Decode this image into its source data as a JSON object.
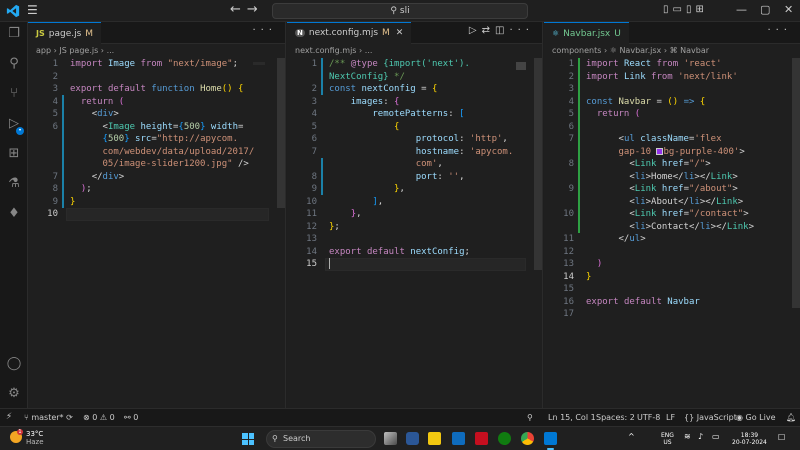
{
  "titlebar": {
    "search_text": "sli",
    "menu_icon": "hamburger-menu-icon",
    "controls": {
      "minimize": "—",
      "maximize": "▢",
      "close": "✕"
    }
  },
  "activity_bar": {
    "items": [
      "explorer-icon",
      "search-icon",
      "source-control-icon",
      "run-debug-icon",
      "extensions-icon",
      "testing-icon",
      "mongodb-leaf-icon"
    ],
    "bottom": [
      "account-icon",
      "settings-gear-icon"
    ]
  },
  "editors": [
    {
      "tab": {
        "icon_text": "JS",
        "name": "page.js",
        "status": "M"
      },
      "breadcrumb": [
        "app",
        "JS page.js",
        "..."
      ],
      "lines": [
        {
          "n": "1",
          "html": "<span class='kw'>import</span> <span class='var'>Image</span> <span class='kw'>from</span> <span class='str'>\"next/image\"</span><span class='plain'>;</span>"
        },
        {
          "n": "2",
          "html": ""
        },
        {
          "n": "3",
          "html": "<span class='kw'>export</span> <span class='kw'>default</span> <span class='kw2'>function</span> <span class='fn'>Home</span><span class='bracket1'>()</span> <span class='bracket1'>{</span>"
        },
        {
          "n": "4",
          "html": "  <span class='kw'>return</span> <span class='bracket2'>(</span>"
        },
        {
          "n": "5",
          "html": "    <span class='plain'>&lt;</span><span class='tag'>div</span><span class='plain'>&gt;</span>"
        },
        {
          "n": "6",
          "html": "      <span class='plain'>&lt;</span><span class='type'>Image</span> <span class='attr'>height</span><span class='plain'>=</span><span class='bracket3'>{</span><span class='num'>500</span><span class='bracket3'>}</span> <span class='attr'>width</span><span class='plain'>=</span>"
        },
        {
          "n": "",
          "html": "      <span class='bracket3'>{</span><span class='num'>500</span><span class='bracket3'>}</span> <span class='attr'>src</span><span class='plain'>=</span><span class='str'>\"http://apycom.</span>"
        },
        {
          "n": "",
          "html": "      <span class='str'>com/webdev/data/upload/2017/</span>"
        },
        {
          "n": "",
          "html": "      <span class='str'>05/image-slider1200.jpg\"</span> <span class='plain'>/&gt;</span>"
        },
        {
          "n": "7",
          "html": "    <span class='plain'>&lt;/</span><span class='tag'>div</span><span class='plain'>&gt;</span>"
        },
        {
          "n": "8",
          "html": "  <span class='bracket2'>)</span><span class='plain'>;</span>"
        },
        {
          "n": "9",
          "html": "<span class='bracket1'>}</span>"
        },
        {
          "n": "10",
          "html": ""
        }
      ]
    },
    {
      "tab": {
        "icon_text": "N",
        "name": "next.config.mjs",
        "status": "M"
      },
      "breadcrumb": [
        "next.config.mjs",
        "..."
      ],
      "lines": [
        {
          "n": "1",
          "html": "<span class='cmt'>/** </span><span class='kw'>@type</span> <span class='type'>{import('next').</span>"
        },
        {
          "n": "",
          "html": "<span class='type'>NextConfig}</span><span class='cmt'> */</span>"
        },
        {
          "n": "2",
          "html": "<span class='kw2'>const</span> <span class='var'>nextConfig</span> <span class='plain'>=</span> <span class='bracket1'>{</span>"
        },
        {
          "n": "3",
          "html": "    <span class='var'>images</span><span class='plain'>:</span> <span class='bracket2'>{</span>"
        },
        {
          "n": "4",
          "html": "        <span class='var'>remotePatterns</span><span class='plain'>:</span> <span class='bracket3'>[</span>"
        },
        {
          "n": "5",
          "html": "            <span class='bracket1'>{</span>"
        },
        {
          "n": "6",
          "html": "                <span class='var'>protocol</span><span class='plain'>:</span> <span class='str'>'http'</span><span class='plain'>,</span>"
        },
        {
          "n": "7",
          "html": "                <span class='var'>hostname</span><span class='plain'>:</span> <span class='str'>'apycom.</span>"
        },
        {
          "n": "",
          "html": "                <span class='str'>com'</span><span class='plain'>,</span>"
        },
        {
          "n": "8",
          "html": "                <span class='var'>port</span><span class='plain'>:</span> <span class='str'>''</span><span class='plain'>,</span>"
        },
        {
          "n": "9",
          "html": "            <span class='bracket1'>}</span><span class='plain'>,</span>"
        },
        {
          "n": "10",
          "html": "        <span class='bracket3'>]</span><span class='plain'>,</span>"
        },
        {
          "n": "11",
          "html": "    <span class='bracket2'>}</span><span class='plain'>,</span>"
        },
        {
          "n": "12",
          "html": "<span class='bracket1'>}</span><span class='plain'>;</span>"
        },
        {
          "n": "13",
          "html": ""
        },
        {
          "n": "14",
          "html": "<span class='kw'>export</span> <span class='kw'>default</span> <span class='var'>nextConfig</span><span class='plain'>;</span>"
        },
        {
          "n": "15",
          "html": "<span class='cursor'></span>"
        }
      ]
    },
    {
      "tab": {
        "icon_text": "⚛",
        "name": "Navbar.jsx",
        "status": "U"
      },
      "breadcrumb": [
        "components",
        "⚛ Navbar.jsx",
        "⌘ Navbar"
      ],
      "lines": [
        {
          "n": "1",
          "html": "<span class='kw'>import</span> <span class='var'>React</span> <span class='kw'>from</span> <span class='str'>'react'</span>"
        },
        {
          "n": "2",
          "html": "<span class='kw'>import</span> <span class='var'>Link</span> <span class='kw'>from</span> <span class='str'>'next/link'</span>"
        },
        {
          "n": "3",
          "html": ""
        },
        {
          "n": "4",
          "html": "<span class='kw2'>const</span> <span class='fn'>Navbar</span> <span class='plain'>=</span> <span class='bracket1'>()</span> <span class='kw2'>=&gt;</span> <span class='bracket1'>{</span>"
        },
        {
          "n": "5",
          "html": "  <span class='kw'>return</span> <span class='bracket2'>(</span>"
        },
        {
          "n": "6",
          "html": ""
        },
        {
          "n": "7",
          "html": "      <span class='plain'>&lt;</span><span class='tag'>ul</span> <span class='attr'>className</span><span class='plain'>=</span><span class='str'>'flex</span>"
        },
        {
          "n": "",
          "html": "      <span class='str'>gap-10 </span><span style='display:inline-block;width:7px;height:7px;background:#9333ea;border:1px solid #ccc;vertical-align:middle'></span><span class='str'>bg-purple-400'</span><span class='plain'>&gt;</span>"
        },
        {
          "n": "8",
          "html": "        <span class='plain'>&lt;</span><span class='type'>Link</span> <span class='attr'>href</span><span class='plain'>=</span><span class='str'>\"/\"</span><span class='plain'>&gt;</span>"
        },
        {
          "n": "",
          "html": "        <span class='plain'>&lt;</span><span class='tag'>li</span><span class='plain'>&gt;Home&lt;/</span><span class='tag'>li</span><span class='plain'>&gt;&lt;/</span><span class='type'>Link</span><span class='plain'>&gt;</span>"
        },
        {
          "n": "9",
          "html": "        <span class='plain'>&lt;</span><span class='type'>Link</span> <span class='attr'>href</span><span class='plain'>=</span><span class='str'>\"/about\"</span><span class='plain'>&gt;</span>"
        },
        {
          "n": "",
          "html": "        <span class='plain'>&lt;</span><span class='tag'>li</span><span class='plain'>&gt;About&lt;/</span><span class='tag'>li</span><span class='plain'>&gt;&lt;/</span><span class='type'>Link</span><span class='plain'>&gt;</span>"
        },
        {
          "n": "10",
          "html": "        <span class='plain'>&lt;</span><span class='type'>Link</span> <span class='attr'>href</span><span class='plain'>=</span><span class='str'>\"/contact\"</span><span class='plain'>&gt;</span>"
        },
        {
          "n": "",
          "html": "        <span class='plain'>&lt;</span><span class='tag'>li</span><span class='plain'>&gt;Contact&lt;/</span><span class='tag'>li</span><span class='plain'>&gt;&lt;/</span><span class='type'>Link</span><span class='plain'>&gt;</span>"
        },
        {
          "n": "11",
          "html": "      <span class='plain'>&lt;/</span><span class='tag'>ul</span><span class='plain'>&gt;</span>"
        },
        {
          "n": "12",
          "html": ""
        },
        {
          "n": "13",
          "html": "  <span class='bracket2'>)</span>"
        },
        {
          "n": "14",
          "html": "<span class='bracket1'>}</span>"
        },
        {
          "n": "15",
          "html": ""
        },
        {
          "n": "16",
          "html": "<span class='kw'>export</span> <span class='kw'>default</span> <span class='var'>Navbar</span>"
        },
        {
          "n": "17",
          "html": ""
        }
      ]
    }
  ],
  "statusbar": {
    "branch": "master*",
    "errors": "0",
    "warnings": "0",
    "ports": "0",
    "position": "Ln 15, Col 1",
    "spaces": "Spaces: 2",
    "encoding": "UTF-8",
    "eol": "LF",
    "language": "JavaScript",
    "golive": "Go Live"
  },
  "taskbar": {
    "weather_temp": "33°C",
    "weather_desc": "Haze",
    "weather_badge": "1",
    "search_placeholder": "Search",
    "lang": "ENG",
    "region": "US",
    "time": "18:39",
    "date": "20-07-2024"
  },
  "colors": {
    "accent": "#0078d4",
    "modified": "#e2c08d",
    "untracked": "#73c991"
  }
}
